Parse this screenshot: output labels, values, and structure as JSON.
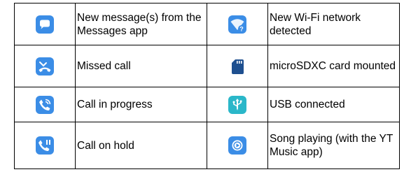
{
  "rows": [
    {
      "left": {
        "icon": "message-bubble-icon",
        "text": "New message(s) from the Messages app"
      },
      "right": {
        "icon": "wifi-new-network-icon",
        "text": "New Wi-Fi network detected"
      }
    },
    {
      "left": {
        "icon": "missed-call-icon",
        "text": "Missed call"
      },
      "right": {
        "icon": "sd-card-icon",
        "text": "microSDXC card mounted"
      }
    },
    {
      "left": {
        "icon": "call-in-progress-icon",
        "text": "Call in progress"
      },
      "right": {
        "icon": "usb-icon",
        "text": "USB connected"
      }
    },
    {
      "left": {
        "icon": "call-on-hold-icon",
        "text": "Call on hold"
      },
      "right": {
        "icon": "music-play-icon",
        "text": "Song playing (with the YT Music app)"
      }
    }
  ],
  "colors": {
    "icon_blue": "#3b8de6",
    "icon_teal": "#2ab7c9",
    "icon_dark": "#1e4f8f",
    "border": "#000000"
  }
}
